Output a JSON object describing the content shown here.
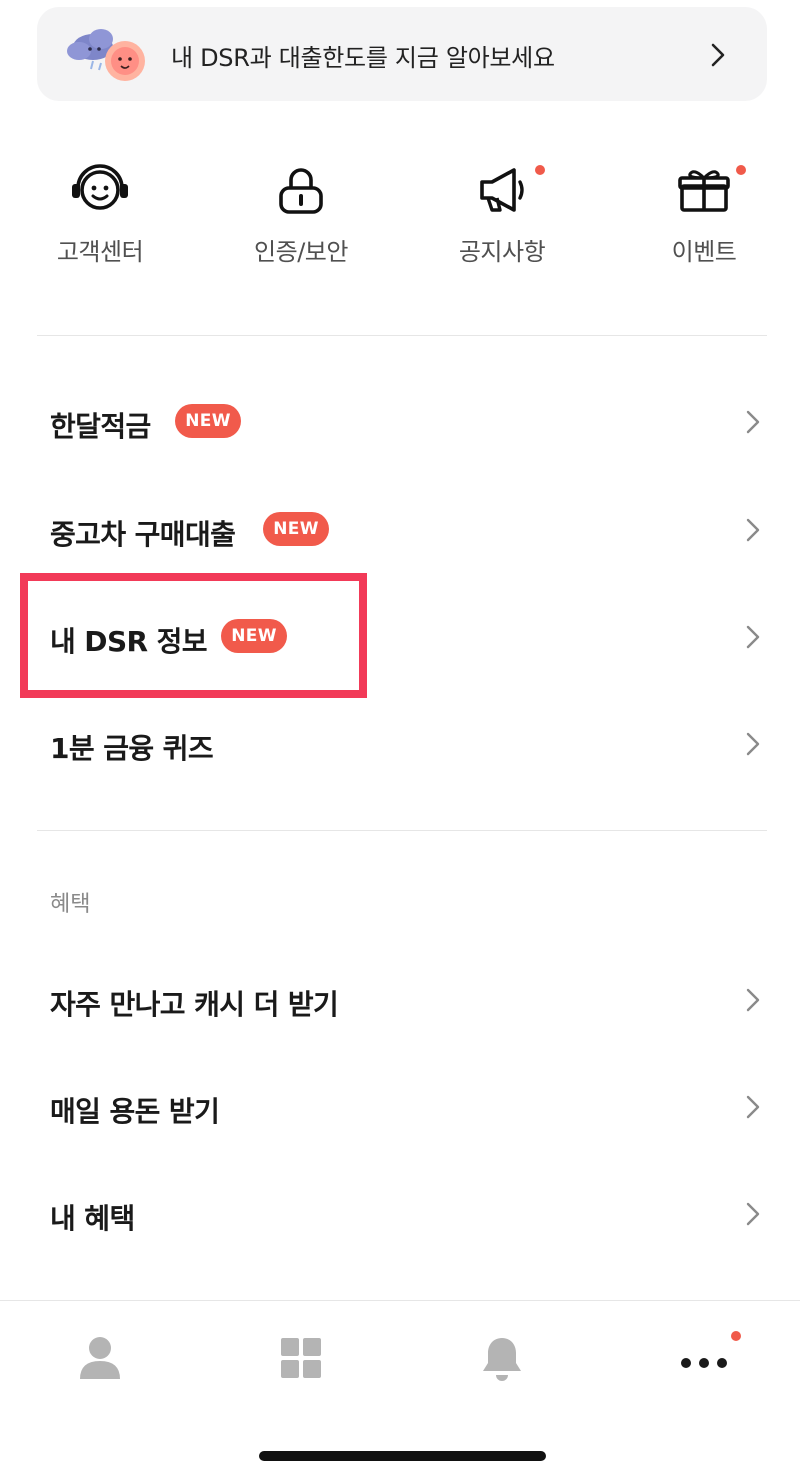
{
  "banner": {
    "text": "내 DSR과 대출한도를 지금 알아보세요"
  },
  "quick_menu": [
    {
      "label": "고객센터",
      "icon": "headset-smile-icon",
      "has_dot": false
    },
    {
      "label": "인증/보안",
      "icon": "lock-icon",
      "has_dot": false
    },
    {
      "label": "공지사항",
      "icon": "megaphone-icon",
      "has_dot": true
    },
    {
      "label": "이벤트",
      "icon": "gift-icon",
      "has_dot": true
    }
  ],
  "menu": [
    {
      "label": "한달적금",
      "badge": "NEW"
    },
    {
      "label": "중고차 구매대출",
      "badge": "NEW"
    },
    {
      "label": "내 DSR 정보",
      "badge": "NEW",
      "highlighted": true
    },
    {
      "label": "1분 금융 퀴즈",
      "badge": ""
    }
  ],
  "benefits": {
    "section_label": "혜택",
    "items": [
      {
        "label": "자주 만나고 캐시 더 받기"
      },
      {
        "label": "매일 용돈 받기"
      },
      {
        "label": "내 혜택"
      }
    ]
  },
  "tabbar": [
    {
      "icon": "person-icon",
      "active": false
    },
    {
      "icon": "grid-icon",
      "active": false
    },
    {
      "icon": "bell-icon",
      "active": false
    },
    {
      "icon": "more-dots-icon",
      "active": true,
      "has_dot": true
    }
  ],
  "colors": {
    "accent": "#f15a4b",
    "highlight_border": "#f23a58",
    "icon_inactive": "#b4b4b4"
  }
}
